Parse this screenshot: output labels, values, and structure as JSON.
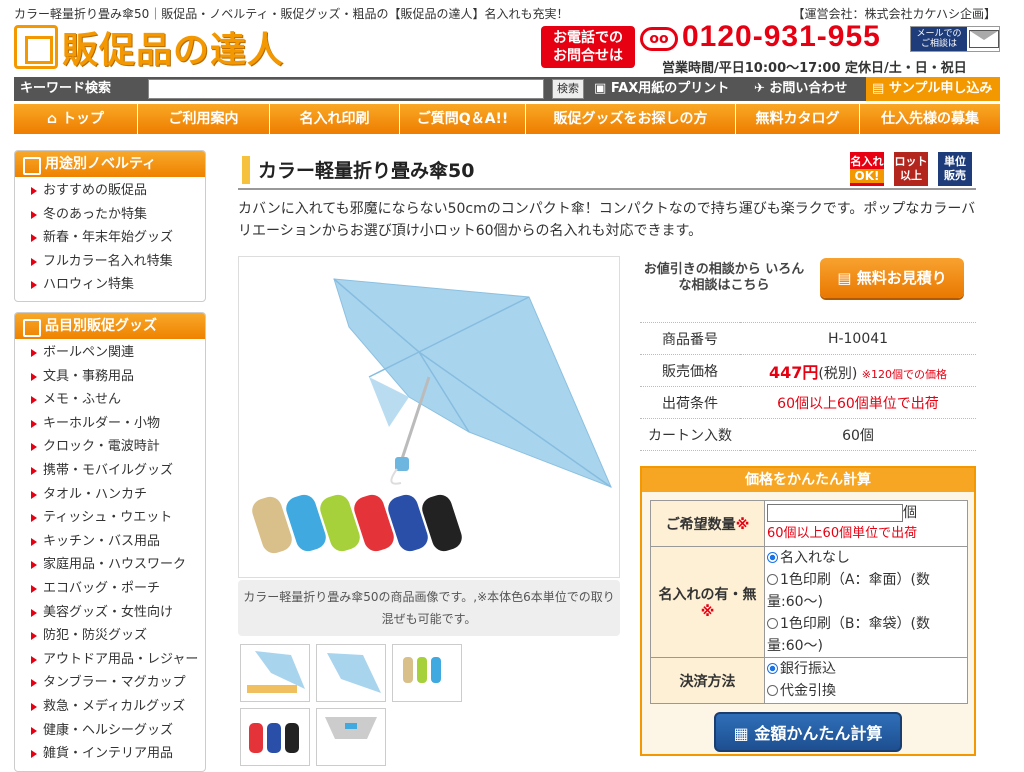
{
  "header": {
    "top_text": "カラー軽量折り畳み傘50｜販促品・ノベルティ・販促グッズ・粗品の【販促品の達人】名入れも充実！",
    "company": "【運営会社：株式会社カケハシ企画】",
    "logo_text": "販促品の達人",
    "phone_badge_line1": "お電話での",
    "phone_badge_line2": "お問合せは",
    "freedial": "ᴏᴏ",
    "phone_number": "0120-931-955",
    "mail_label": "メールでの ご相談は",
    "hours": "営業時間/平日10:00〜17:00 定休日/土・日・祝日"
  },
  "searchbar": {
    "label": "キーワード検索",
    "placeholder": "",
    "button": "検索",
    "fax": "FAX用紙のプリント",
    "contact": "お問い合わせ",
    "sample": "サンプル申し込み"
  },
  "nav": [
    "トップ",
    "ご利用案内",
    "名入れ印刷",
    "ご質問Q＆A!!",
    "販促グッズをお探しの方",
    "無料カタログ",
    "仕入先様の募集"
  ],
  "sidebar": {
    "section1_title": "用途別ノベルティ",
    "section1_items": [
      "おすすめの販促品",
      "冬のあったか特集",
      "新春・年末年始グッズ",
      "フルカラー名入れ特集",
      "ハロウィン特集"
    ],
    "section2_title": "品目別販促グッズ",
    "section2_items": [
      "ボールペン関連",
      "文具・事務用品",
      "メモ・ふせん",
      "キーホルダー・小物",
      "クロック・電波時計",
      "携帯・モバイルグッズ",
      "タオル・ハンカチ",
      "ティッシュ・ウエット",
      "キッチン・バス用品",
      "家庭用品・ハウスワーク",
      "エコバッグ・ポーチ",
      "美容グッズ・女性向け",
      "防犯・防災グッズ",
      "アウトドア用品・レジャー",
      "タンブラー・マグカップ",
      "救急・メディカルグッズ",
      "健康・ヘルシーグッズ",
      "雑貨・インテリア用品"
    ]
  },
  "product": {
    "title": "カラー軽量折り畳み傘50",
    "badges": [
      {
        "line1": "名入れ",
        "line2": "OK!",
        "color": "#e60012"
      },
      {
        "line1": "ロット",
        "line2": "以上",
        "color": "#b3261e"
      },
      {
        "line1": "単位",
        "line2": "販売",
        "color": "#1e3c7a"
      }
    ],
    "description": "カバンに入れても邪魔にならない50cmのコンパクト傘！コンパクトなので持ち運びも楽ラクです。ポップなカラーバリエーションからお選び頂け小ロット60個からの名入れも対応できます。",
    "caption": "カラー軽量折り畳み傘50の商品画像です。,※本体色6本単位での取り混ぜも可能です。",
    "consult": "お値引きの相談から いろんな相談はこちら",
    "quote_button": "無料お見積り",
    "spec": {
      "code_label": "商品番号",
      "code": "H-10041",
      "price_label": "販売価格",
      "price": "447円",
      "tax": "(税別)",
      "price_note": "※120個での価格",
      "ship_label": "出荷条件",
      "ship": "60個以上60個単位で出荷",
      "carton_label": "カートン入数",
      "carton": "60個"
    }
  },
  "calc": {
    "title": "価格をかんたん計算",
    "qty_label": "ご希望数量",
    "qty_unit": "個",
    "qty_note": "60個以上60個単位で出荷",
    "print_label": "名入れの有・無",
    "print_options": [
      "名入れなし",
      "1色印刷（A：傘面）(数量:60〜)",
      "1色印刷（B：傘袋）(数量:60〜)"
    ],
    "pay_label": "決済方法",
    "pay_options": [
      "銀行振込",
      "代金引換"
    ],
    "button": "金額かんたん計算"
  },
  "colors": {
    "accent": "#f39800",
    "red": "#e60012",
    "navy": "#1e3c7a"
  }
}
